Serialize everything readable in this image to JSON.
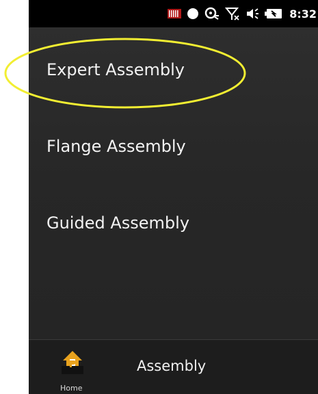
{
  "status_bar": {
    "icons": [
      "signal-bars-icon",
      "circle-icon",
      "sync-icon",
      "no-signal-icon",
      "speaker-icon",
      "battery-icon"
    ],
    "time": "8:32"
  },
  "menu": {
    "items": [
      {
        "label": "Expert Assembly",
        "highlighted": true
      },
      {
        "label": "Flange Assembly",
        "highlighted": false
      },
      {
        "label": "Guided Assembly",
        "highlighted": false
      }
    ]
  },
  "bottom_bar": {
    "home_label": "Home",
    "home_icon": "home-icon",
    "title": "Assembly"
  },
  "colors": {
    "highlight": "#f2ee32",
    "home_icon": "#e8a21e",
    "background": "#2a2a2a",
    "statusbar": "#000000"
  }
}
